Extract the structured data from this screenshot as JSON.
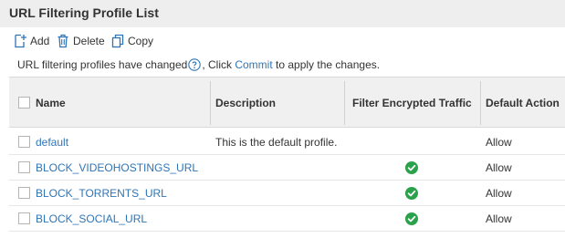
{
  "page": {
    "title": "URL Filtering Profile List"
  },
  "toolbar": {
    "add_label": "Add",
    "delete_label": "Delete",
    "copy_label": "Copy"
  },
  "notice": {
    "before": "URL filtering profiles have changed",
    "middle": ", Click ",
    "link": "Commit",
    "after": " to apply the changes."
  },
  "table": {
    "columns": {
      "name": "Name",
      "description": "Description",
      "filter_encrypted": "Filter Encrypted Traffic",
      "default_action": "Default Action"
    },
    "rows": [
      {
        "name": "default",
        "description": "This is the default profile.",
        "filter_encrypted": false,
        "default_action": "Allow"
      },
      {
        "name": "BLOCK_VIDEOHOSTINGS_URL",
        "description": "",
        "filter_encrypted": true,
        "default_action": "Allow"
      },
      {
        "name": "BLOCK_TORRENTS_URL",
        "description": "",
        "filter_encrypted": true,
        "default_action": "Allow"
      },
      {
        "name": "BLOCK_SOCIAL_URL",
        "description": "",
        "filter_encrypted": true,
        "default_action": "Allow"
      }
    ]
  },
  "icons": {
    "add": "add-icon",
    "delete": "trash-icon",
    "copy": "copy-icon",
    "help": "help-circle-icon",
    "enabled": "check-circle-icon"
  },
  "colors": {
    "accent": "#2f75b5",
    "success": "#2aa14b",
    "header_bg": "#f0f0f0",
    "title_bg": "#eeeeee"
  }
}
